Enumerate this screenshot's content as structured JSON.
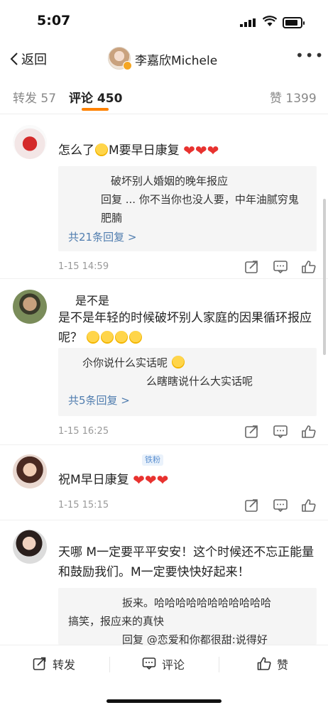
{
  "status_bar": {
    "time": "5:07"
  },
  "nav": {
    "back_label": "返回",
    "title": "李嘉欣Michele",
    "more_label": "•••"
  },
  "tabs": [
    {
      "label": "转发",
      "count": "57"
    },
    {
      "label": "评论",
      "count": "450"
    },
    {
      "label": "赞",
      "count": "1399"
    }
  ],
  "comments": [
    {
      "text_before": "怎么了",
      "text_mid": "M要早日康复",
      "replies": [
        "破坏别人婚姻的晚年报应",
        "回复 ... 你不当你也没人要，中年油腻穷鬼肥腩"
      ],
      "more_replies": "共21条回复 >",
      "date": "1-15 14:59"
    },
    {
      "username": "是不是",
      "text": "是不是年轻的时候破坏别人家庭的因果循环报应呢？",
      "replies": [
        "尒你说什么实话呢",
        "么瞎瞎说什么大实话呢"
      ],
      "more_replies": "共5条回复 >",
      "date": "1-15 16:25"
    },
    {
      "username": "铁粉",
      "text": "祝M早日康复",
      "date": "1-15 15:15"
    },
    {
      "text": "天哪 M一定要平平安安！这个时候还不忘正能量和鼓励我们。M一定要快快好起来！",
      "replies": [
        "扳来。哈哈哈哈哈哈哈哈哈哈哈",
        "搞笑，报应来的真快",
        "回复 @恋爱和你都很甜:说得好"
      ]
    }
  ],
  "toolbar": {
    "repost": "转发",
    "comment": "评论",
    "like": "赞"
  },
  "colors": {
    "accent": "#ff8200",
    "link": "#507daf",
    "heart": "#e8322f"
  }
}
